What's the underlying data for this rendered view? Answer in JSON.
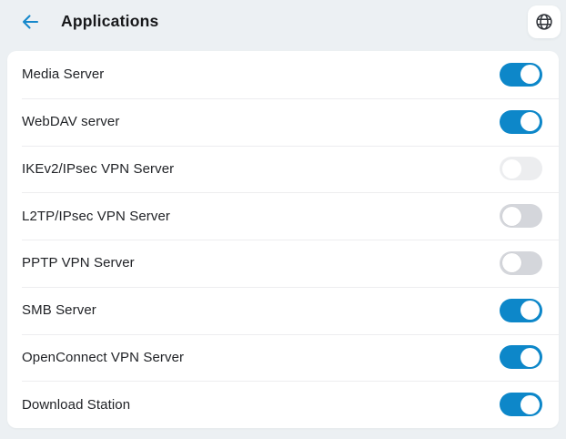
{
  "header": {
    "title": "Applications",
    "back_icon": "left-arrow",
    "language_icon": "globe"
  },
  "colors": {
    "accent_blue": "#0d87c9",
    "page_background": "#ecf0f3",
    "card_background": "#ffffff",
    "toggle_off_track": "#d4d6db",
    "divider": "#ededef",
    "label_text": "#212327",
    "title_text": "#17181a"
  },
  "apps": [
    {
      "label": "Media Server",
      "state": "on"
    },
    {
      "label": "WebDAV server",
      "state": "on"
    },
    {
      "label": "IKEv2/IPsec VPN Server",
      "state": "off-faded"
    },
    {
      "label": "L2TP/IPsec VPN Server",
      "state": "off"
    },
    {
      "label": "PPTP VPN Server",
      "state": "off"
    },
    {
      "label": "SMB Server",
      "state": "on"
    },
    {
      "label": "OpenConnect VPN Server",
      "state": "on"
    },
    {
      "label": "Download Station",
      "state": "on"
    }
  ]
}
